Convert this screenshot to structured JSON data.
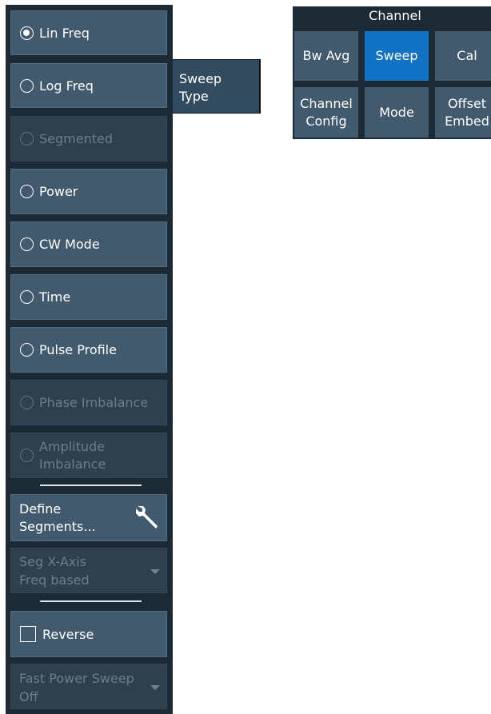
{
  "sweep_type_panel": {
    "options": [
      {
        "label": "Lin Freq",
        "selected": true,
        "enabled": true
      },
      {
        "label": "Log Freq",
        "selected": false,
        "enabled": true
      },
      {
        "label": "Segmented",
        "selected": false,
        "enabled": false
      },
      {
        "label": "Power",
        "selected": false,
        "enabled": true
      },
      {
        "label": "CW Mode",
        "selected": false,
        "enabled": true
      },
      {
        "label": "Time",
        "selected": false,
        "enabled": true
      },
      {
        "label": "Pulse Profile",
        "selected": false,
        "enabled": true
      },
      {
        "label": "Phase Imbalance",
        "selected": false,
        "enabled": false
      },
      {
        "label_line1": "Amplitude",
        "label_line2": "Imbalance",
        "selected": false,
        "enabled": false
      }
    ],
    "define_segments": {
      "line1": "Define",
      "line2": "Segments...",
      "icon": "wrench-icon"
    },
    "seg_x_axis": {
      "label": "Seg X-Axis",
      "value": "Freq based",
      "enabled": false
    },
    "reverse": {
      "label": "Reverse",
      "checked": false
    },
    "fast_power_sweep": {
      "label": "Fast Power Sweep",
      "value": "Off",
      "enabled": false
    }
  },
  "sweep_type_tab": {
    "line1": "Sweep",
    "line2": "Type"
  },
  "channel_menu": {
    "title": "Channel",
    "buttons": {
      "bw_avg": "Bw Avg",
      "sweep": "Sweep",
      "cal": "Cal",
      "channel_config_line1": "Channel",
      "channel_config_line2": "Config",
      "mode": "Mode",
      "offset_embed_line1": "Offset",
      "offset_embed_line2": "Embed"
    },
    "active_button": "Sweep"
  },
  "colors": {
    "panel_bg": "#1c2a36",
    "button_bg": "#425a6e",
    "button_disabled_bg": "#2e3f4d",
    "active_blue": "#1272c4",
    "disabled_text": "#6a7e8d"
  }
}
